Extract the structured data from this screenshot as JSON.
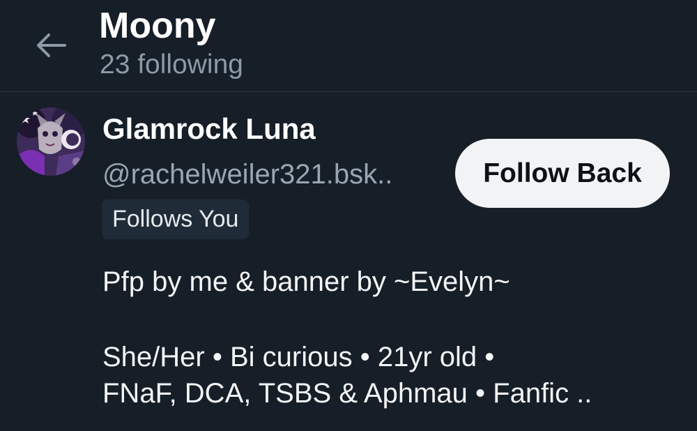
{
  "header": {
    "back_icon": "arrow-left-icon",
    "title": "Moony",
    "subtitle": "23 following"
  },
  "profile": {
    "avatar_icon": "avatar-image",
    "display_name": "Glamrock Luna",
    "handle": "@rachelweiler321.bsk..",
    "follows_you_badge": "Follows You",
    "follow_back_label": "Follow Back",
    "bio": {
      "line1": "Pfp by me & banner by ~Evelyn~",
      "line2": "She/Her • Bi curious • 21yr old •",
      "line3": "FNaF, DCA, TSBS & Aphmau • Fanfic .."
    }
  },
  "colors": {
    "background": "#161e27",
    "muted_text": "#8c9aa8",
    "button_bg": "#f1f3f5",
    "badge_bg": "#1f2b37",
    "divider": "#2e3944"
  }
}
